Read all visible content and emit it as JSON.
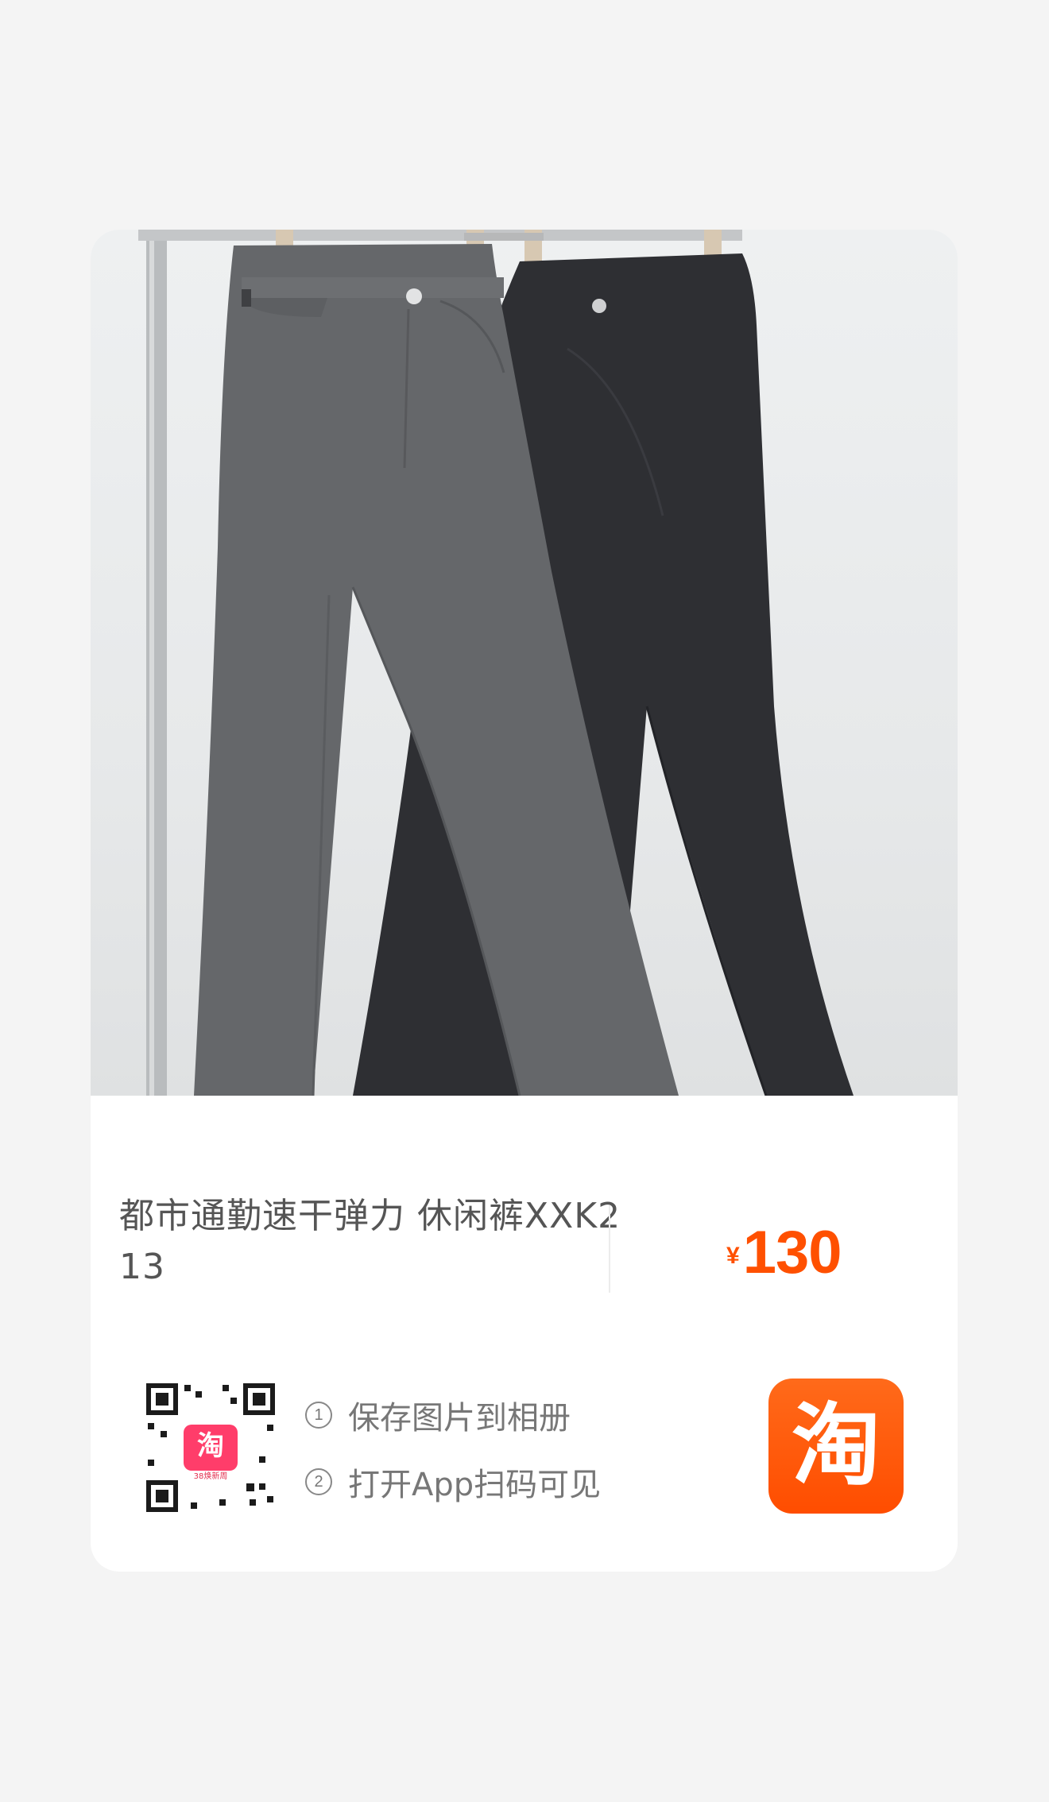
{
  "product": {
    "title": "都市通勤速干弹力 休闲裤XXK213",
    "price_currency": "¥",
    "price_value": "130"
  },
  "share": {
    "step1_number": "1",
    "step1_text": "保存图片到相册",
    "step2_number": "2",
    "step2_text": "打开App扫码可见",
    "qr_badge_text": "淘",
    "qr_badge_caption": "38焕新周",
    "app_logo_text": "淘"
  },
  "colors": {
    "accent": "#ff5000",
    "logo_bg": "#ff5a0d"
  },
  "icons": {
    "qr": "qr-code-icon",
    "logo": "taobao-logo-icon"
  }
}
